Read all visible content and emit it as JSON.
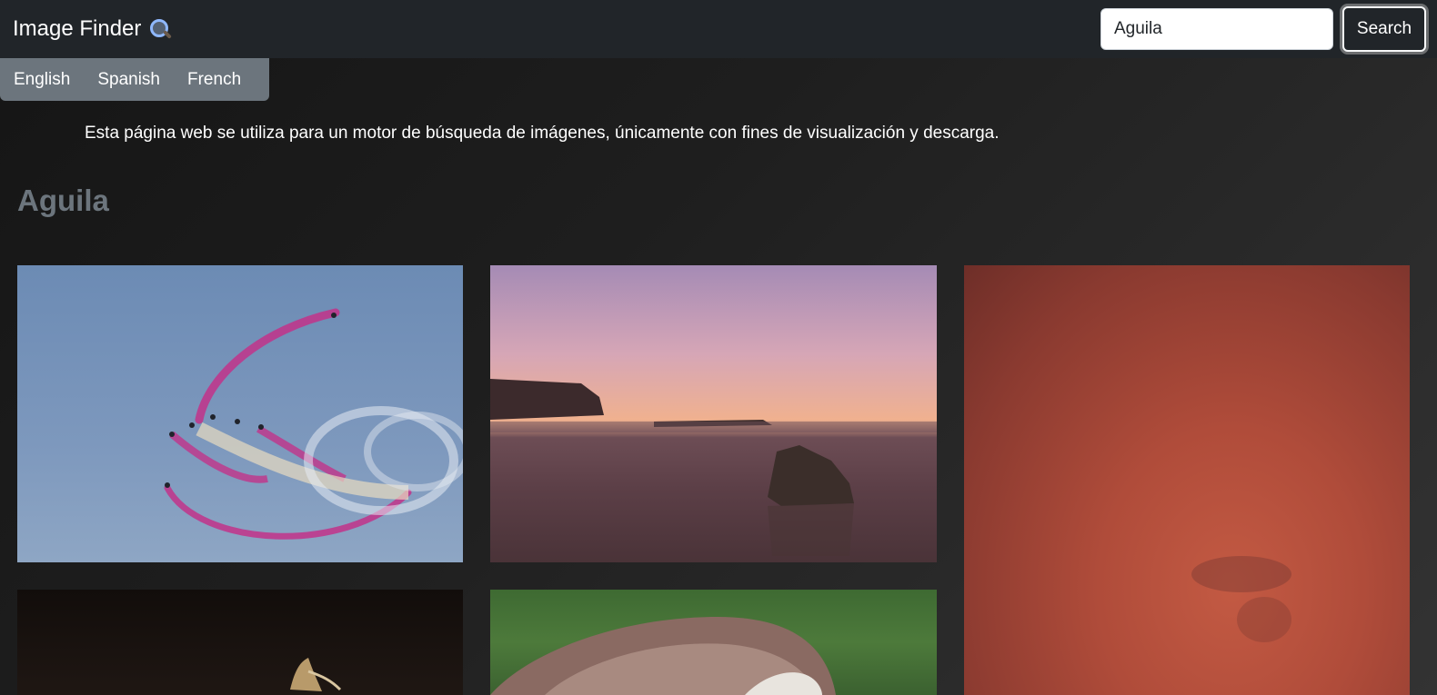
{
  "app": {
    "title": "Image Finder",
    "icon": "magnifying-glass-icon"
  },
  "search": {
    "value": "Aguila",
    "button_label": "Search"
  },
  "languages": [
    "English",
    "Spanish",
    "French"
  ],
  "description": "Esta página web se utiliza para un motor de búsqueda de imágenes, únicamente con fines de visualización y descarga.",
  "results": {
    "heading": "Aguila",
    "images": [
      {
        "subject": "aerobatic jets with pink smoke trails"
      },
      {
        "subject": "beach at sunset with rocks"
      },
      {
        "subject": "blurred red background with bird"
      },
      {
        "subject": "eagle flying against dark background"
      },
      {
        "subject": "eagle head close-up on green background"
      }
    ]
  },
  "colors": {
    "navbar": "#212529",
    "language_bar": "#6c757d",
    "heading": "#6c757d"
  }
}
